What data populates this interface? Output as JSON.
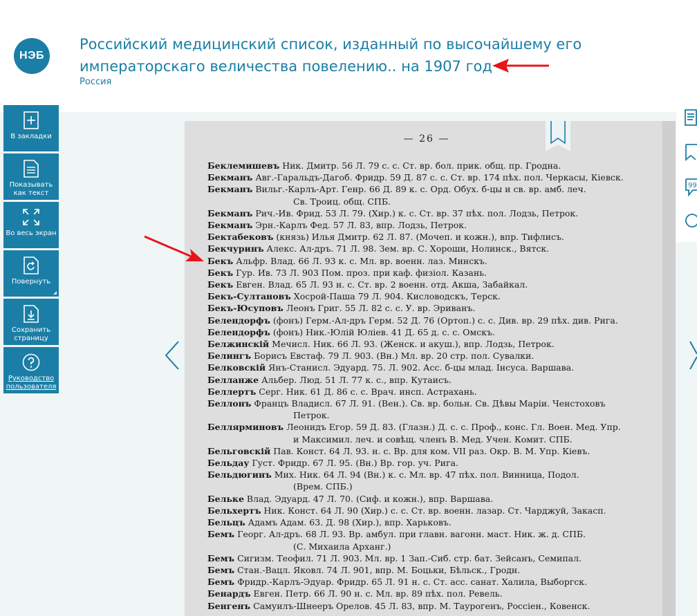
{
  "header": {
    "logo_text": "НЭБ",
    "title": "Российский медицинский список, изданный по высочайшему его императорскаго величества повелению.. на 1907 год",
    "subtitle": "Россия"
  },
  "toolbar": {
    "items": [
      {
        "label": "В закладки",
        "icon": "bookmark-add-icon"
      },
      {
        "label": "Показывать как текст",
        "icon": "document-text-icon"
      },
      {
        "label": "Во весь экран",
        "icon": "fullscreen-icon"
      },
      {
        "label": "Повернуть",
        "icon": "rotate-icon"
      },
      {
        "label": "Сохранить страницу",
        "icon": "save-page-icon"
      },
      {
        "label": "Руководство пользователя",
        "icon": "help-icon"
      }
    ]
  },
  "colors": {
    "accent": "#1b7ea6",
    "arrow": "#e8141c",
    "viewer_bg": "#f0f5f6",
    "page_bg": "#dedede"
  },
  "page": {
    "page_number": "— 26 —",
    "entries": [
      {
        "name": "Беклемишевъ",
        "text": "Ник. Дмитр. 56 Л. 79 с. с. Ст. вр. бол. прик. общ. пр. Гродна."
      },
      {
        "name": "Бекманъ",
        "text": "Авг.-Гаральдъ-Дагоб. Фридр. 59 Д. 87 с. с. Ст. вр. 174 пѣх. пол. Черкасы, Кіевск."
      },
      {
        "name": "Бекманъ",
        "text": "Вильг.-Карлъ-Арт. Генр. 66 Д. 89 к. с. Орд. Обух. б-цы и св. вр. амб. леч.",
        "cont": "Св. Троиц. общ. СПБ."
      },
      {
        "name": "Бекманъ",
        "text": "Рич.-Ив. Фрид. 53 Л. 79. (Хир.) к. с. Ст. вр. 37 пѣх. пол. Лодзь, Петрок."
      },
      {
        "name": "Бекманъ",
        "text": "Эрн.-Карлъ Фед. 57 Л. 83, впр. Лодзь, Петрок."
      },
      {
        "name": "Бектабековъ",
        "text": "(князь) Илья Дмитр. 62 Л. 87. (Мочеп. и кожн.), впр. Тифлисъ."
      },
      {
        "name": "Бекчуринъ",
        "text": "Алекс. Ал-дръ. 71 Л. 98. Зем. вр. С. Хороши, Нолинск., Вятск."
      },
      {
        "name": "Бекъ",
        "text": "Альфр. Влад. 66 Л. 93 к. с. Мл. вр. военн. лаз. Минскъ."
      },
      {
        "name": "Бекъ",
        "text": "Гур. Ив. 73 Л. 903 Пом. проз. при каф. физіол. Казань."
      },
      {
        "name": "Бекъ",
        "text": "Евген. Влад. 65 Л. 93 н. с. Ст. вр. 2 военн. отд. Акша, Забайкал."
      },
      {
        "name": "Бекъ-Султановъ",
        "text": "Хосрой-Паша 79 Л. 904. Кисловодскъ, Терск."
      },
      {
        "name": "Бекъ-Юсуповъ",
        "text": "Леонъ Григ. 55 Л. 82 с. с. У. вр. Эриванъ."
      },
      {
        "name": "Белендорфъ",
        "text": "(фонъ) Герм.-Ал-дръ Герм. 52 Д. 76 (Ортоп.) с. с. Див. вр. 29 пѣх. див. Рига."
      },
      {
        "name": "Белендорфъ",
        "text": "(фонъ) Ник.-Юлій Юліев. 41 Д. 65 д. с. с. Омскъ."
      },
      {
        "name": "Белжинскій",
        "text": "Мечисл. Ник. 66 Л. 93. (Женск. и акуш.), впр. Лодзь, Петрок."
      },
      {
        "name": "Белингъ",
        "text": "Борисъ Евстаф. 79 Л. 903. (Вн.) Мл. вр. 20 стр. пол. Сувалки."
      },
      {
        "name": "Белковскій",
        "text": "Янъ-Станисл. Эдуард. 75. Л. 902. Асс. б-цы млад. Інсуса. Варшава."
      },
      {
        "name": "Белланже",
        "text": "Альбер. Люд. 51 Л. 77 к. с., впр. Кутаисъ."
      },
      {
        "name": "Беллертъ",
        "text": "Серг. Ник. 61 Д. 86 с. с. Врач. инсп. Астрахань."
      },
      {
        "name": "Беллонъ",
        "text": "Францъ Владисл. 67 Л. 91. (Вен.). Св. вр. больн. Св. Дѣвы Маріи. Ченстоховъ",
        "cont": "Петрок."
      },
      {
        "name": "Беллярминовъ",
        "text": "Леонидъ Егор. 59 Д. 83. (Глазн.) Д. с. с. Проф., конс. Гл. Воен. Мед. Упр.",
        "cont": "и Максимил. леч. и совѣщ. членъ В. Мед. Учен. Комит. СПБ."
      },
      {
        "name": "Бельговскій",
        "text": "Пав. Конст. 64 Л. 93. н. с. Вр. для ком. VII раз. Окр. В. М. Упр. Кіевъ."
      },
      {
        "name": "Бельдау",
        "text": "Густ. Фридр. 67 Л. 95. (Вн.) Вр. гор. уч. Рига."
      },
      {
        "name": "Бельдюгинъ",
        "text": "Мих. Ник. 64 Л. 94 (Вн.) к. с. Мл. вр. 47 пѣх. пол. Винница, Подол.",
        "cont": "(Врем. СПБ.)"
      },
      {
        "name": "Бельке",
        "text": "Влад. Эдуард. 47 Л. 70. (Сиф. и кожн.), впр. Варшава."
      },
      {
        "name": "Бельхертъ",
        "text": "Ник. Конст. 64 Л. 90 (Хир.) с. с. Ст. вр. военн. лазар. Ст. Чарджуй, Закасп."
      },
      {
        "name": "Бельцъ",
        "text": "Адамъ Адам. 63. Д. 98 (Хир.), впр. Харьковъ."
      },
      {
        "name": "Бемъ",
        "text": "Георг. Ал-дръ. 68 Л. 93. Вр. амбул. при главн. вагонн. маст. Ник. ж. д. СПБ.",
        "cont": "(С. Михаила Арханг.)"
      },
      {
        "name": "Бемъ",
        "text": "Сигизм. Теофил. 71 Л. 903. Мл. вр. 1 Зап.-Сиб. стр. бат. Зейсанъ, Семипал."
      },
      {
        "name": "Бемъ",
        "text": "Стан.-Вацл. Яковл. 74 Л. 901, впр. М. Боцьки, Бѣльск., Гродн."
      },
      {
        "name": "Бемъ",
        "text": "Фридр.-Карлъ-Эдуар. Фридр. 65 Л. 91 н. с. Ст. асс. санат. Халила, Выборгск."
      },
      {
        "name": "Бенардъ",
        "text": "Евген. Петр. 66 Л. 90 н. с. Мл. вр. 89 пѣх. пол. Ревель."
      },
      {
        "name": "Бенгенъ",
        "text": "Самуилъ-Шнееръ Орелов. 45 Л. 83, впр. М. Таурогенъ, Россіен., Ковенск."
      }
    ]
  }
}
